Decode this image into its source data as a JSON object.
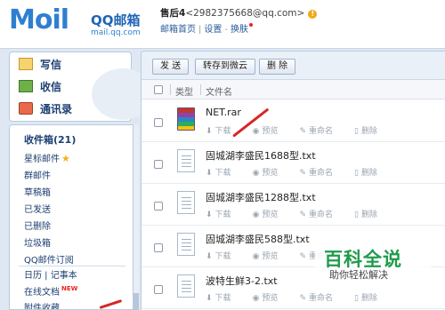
{
  "logo": {
    "mo": "M",
    "oil": "oil",
    "qq_text": "QQ邮箱",
    "domain": "mail.qq.com"
  },
  "account": {
    "name": "售后4",
    "email": "<2982375668@qq.com>",
    "warn": "!"
  },
  "header_links": {
    "home": "邮箱首页",
    "settings": "设置",
    "skin": "换肤"
  },
  "left_buttons": {
    "write": "写信",
    "receive": "收信",
    "contacts": "通讯录"
  },
  "nav": {
    "inbox": "收件箱(21)",
    "items": [
      "星标邮件",
      "群邮件",
      "草稿箱",
      "已发送",
      "已删除",
      "垃圾箱",
      "QQ邮件订阅"
    ],
    "calendar": "日历",
    "notebook": "记事本",
    "online_docs": "在线文档",
    "new_badge": "NEW",
    "favorites": "附件收藏"
  },
  "toolbar": {
    "send": "发 送",
    "save_weiyun": "转存到微云",
    "delete": "删 除"
  },
  "table_header": {
    "type": "类型",
    "filename": "文件名"
  },
  "actions": {
    "download": "下载",
    "preview": "预览",
    "rename": "重命名",
    "delete": "删除"
  },
  "files": [
    {
      "name": "NET.rar",
      "kind": "rar"
    },
    {
      "name": "固城湖李盛民1688型.txt",
      "kind": "txt"
    },
    {
      "name": "固城湖李盛民1288型.txt",
      "kind": "txt"
    },
    {
      "name": "固城湖李盛民588型.txt",
      "kind": "txt"
    },
    {
      "name": "波特生鲜3-2.txt",
      "kind": "txt"
    }
  ],
  "watermark": {
    "title": "百科全说",
    "subtitle": "助你轻松解决"
  },
  "colors": {
    "accent": "#2f7fd1",
    "link": "#1c3f72",
    "arrow": "#d62727",
    "watermark": "#1f9b4b"
  }
}
